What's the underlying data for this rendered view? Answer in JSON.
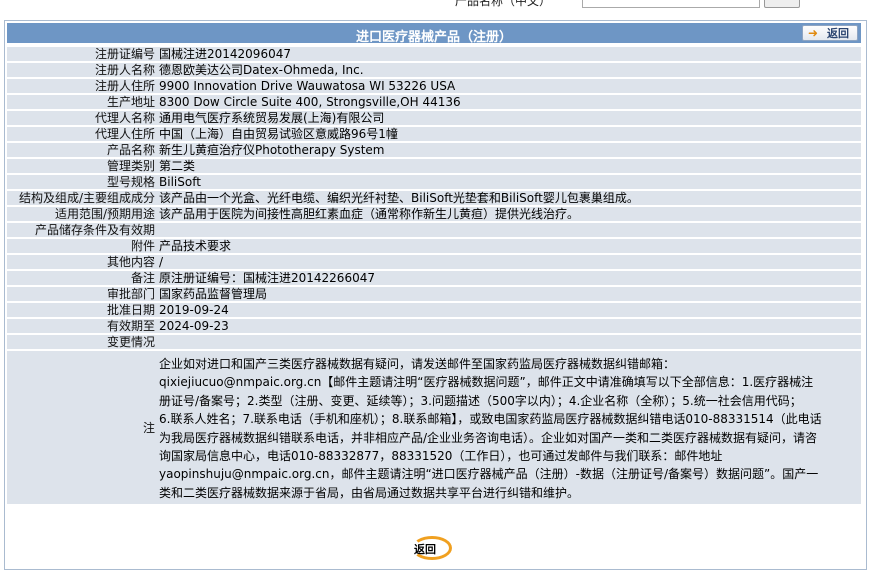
{
  "search": {
    "label": "产品名称（中文）"
  },
  "header": {
    "title": "进口医疗器械产品（注册）",
    "back_label": "返回"
  },
  "fields": [
    {
      "label": "注册证编号",
      "value": "国械注进20142096047"
    },
    {
      "label": "注册人名称",
      "value": "德恩欧美达公司Datex-Ohmeda, Inc."
    },
    {
      "label": "注册人住所",
      "value": "9900 Innovation Drive Wauwatosa WI 53226 USA"
    },
    {
      "label": "生产地址",
      "value": "8300 Dow Circle Suite 400, Strongsville,OH 44136"
    },
    {
      "label": "代理人名称",
      "value": "通用电气医疗系统贸易发展(上海)有限公司"
    },
    {
      "label": "代理人住所",
      "value": "中国（上海）自由贸易试验区意威路96号1幢"
    },
    {
      "label": "产品名称",
      "value": "新生儿黄疸治疗仪Phototherapy System"
    },
    {
      "label": "管理类别",
      "value": "第二类"
    },
    {
      "label": "型号规格",
      "value": "BiliSoft"
    },
    {
      "label": "结构及组成/主要组成成分",
      "value": "该产品由一个光盒、光纤电缆、编织光纤衬垫、BiliSoft光垫套和BiliSoft婴儿包裹巢组成。"
    },
    {
      "label": "适用范围/预期用途",
      "value": "该产品用于医院为间接性高胆红素血症（通常称作新生儿黄疸）提供光线治疗。"
    },
    {
      "label": "产品储存条件及有效期",
      "value": ""
    },
    {
      "label": "附件",
      "value": "产品技术要求"
    },
    {
      "label": "其他内容",
      "value": "/"
    },
    {
      "label": "备注",
      "value": "原注册证编号：国械注进20142266047"
    },
    {
      "label": "审批部门",
      "value": "国家药品监督管理局"
    },
    {
      "label": "批准日期",
      "value": "2019-09-24"
    },
    {
      "label": "有效期至",
      "value": "2024-09-23"
    },
    {
      "label": "变更情况",
      "value": ""
    }
  ],
  "remark": {
    "label": "注",
    "lines": [
      "企业如对进口和国产三类医疗器械数据有疑问，请发送邮件至国家药监局医疗器械数据纠错邮箱：",
      "qixiejiucuo@nmpaic.org.cn【邮件主题请注明“医疗器械数据问题”，邮件正文中请准确填写以下全部信息：1.医疗器械注",
      "册证号/备案号；2.类型（注册、变更、延续等）；3.问题描述（500字以内）；4.企业名称（全称）；5.统一社会信用代码；",
      "6.联系人姓名；7.联系电话（手机和座机）；8.联系邮箱】，或致电国家药监局医疗器械数据纠错电话010-88331514（此电话",
      "为我局医疗器械数据纠错联系电话，并非相应产品/企业业务咨询电话）。企业如对国产一类和二类医疗器械数据有疑问，请咨",
      "询国家局信息中心，电话010-88332877，88331520（工作日），也可通过发邮件与我们联系：邮件地址",
      "yaopinshuju@nmpaic.org.cn，邮件主题请注明“进口医疗器械产品（注册）-数据（注册证号/备案号）数据问题”。国产一",
      "类和二类医疗器械数据来源于省局，由省局通过数据共享平台进行纠错和维护。"
    ]
  },
  "footer": {
    "back_label": "返回"
  },
  "colors": {
    "header_bg": "#6e96c5",
    "row_bg": "#dde3eb",
    "accent": "#f0a020"
  }
}
